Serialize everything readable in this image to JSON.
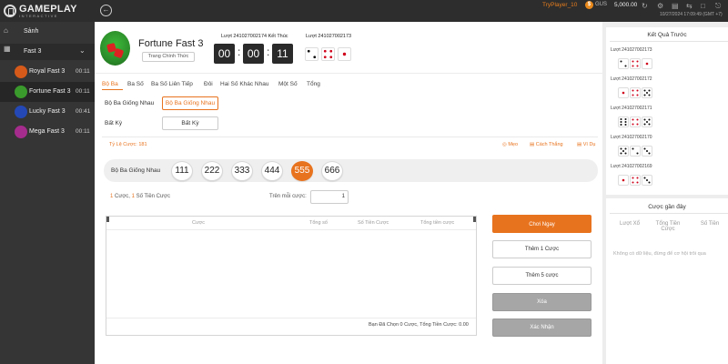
{
  "header": {
    "brand": "GAMEPLAY",
    "brand_sub": "INTERACTIVE",
    "player": "TryPlayer_10",
    "currency": "GUS",
    "balance": "5,000.00",
    "datetime": "10/27/2024 17:09:49 (GMT +7)",
    "back_icon": "arrow-left-icon"
  },
  "sidebar": {
    "home_label": "Sảnh",
    "category": "Fast 3",
    "games": [
      {
        "name": "Royal Fast 3",
        "time": "00:11",
        "color": "#d65a1a"
      },
      {
        "name": "Fortune Fast 3",
        "time": "00:11",
        "color": "#3a9a2c"
      },
      {
        "name": "Lucky Fast 3",
        "time": "00:41",
        "color": "#2448b5"
      },
      {
        "name": "Mega Fast 3",
        "time": "00:11",
        "color": "#a52c8c"
      }
    ]
  },
  "game": {
    "title": "Fortune Fast 3",
    "official_label": "Trang Chính Thức",
    "round_end_label": "Lượt 241027002174 Kết Thúc",
    "timer": [
      "00",
      "00",
      "11"
    ],
    "prev_round_label": "Lượt 241027002173",
    "prev_dice": [
      2,
      4,
      1
    ]
  },
  "tabs": [
    "Bộ Ba",
    "Ba Số",
    "Ba Số Liên Tiếp",
    "Đôi",
    "Hai Số Khác Nhau",
    "Một Số",
    "Tổng"
  ],
  "subtypes": {
    "row1_label": "Bộ Ba Giống Nhau",
    "row1_button": "Bộ Ba Giống Nhau",
    "row2_label": "Bất Kỳ",
    "row2_button": "Bất Kỳ"
  },
  "odds_label": "Tỷ Lệ Cược: 181",
  "hints": {
    "tips": "Mẹo",
    "how_to_win": "Cách Thắng",
    "example": "Ví Dụ"
  },
  "numbers": {
    "label": "Bộ Ba Giống Nhau",
    "options": [
      "111",
      "222",
      "333",
      "444",
      "555",
      "666"
    ],
    "selected": "555"
  },
  "bet_info": {
    "count_num": "1",
    "count_text": " Cược, ",
    "amount_num": "1",
    "amount_text": " Số Tiền Cược",
    "per_bet_label": "Trên mỗi cược:",
    "per_bet_value": "1"
  },
  "table": {
    "headers": [
      "Cược",
      "Tổng số",
      "Số Tiền Cược",
      "Tổng tiền cược"
    ],
    "summary": "Bạn Đã Chọn 0 Cược, Tổng Tiền Cược: 0.00"
  },
  "actions": {
    "play": "Chơi Ngay",
    "add1": "Thêm 1 Cược",
    "add5": "Thêm 5 cược",
    "clear": "Xóa",
    "confirm": "Xác Nhận"
  },
  "results": {
    "title": "Kết Quả Trước",
    "rounds": [
      {
        "label": "Lượt 241027002173",
        "dice": [
          2,
          4,
          1
        ]
      },
      {
        "label": "Lượt 241027002172",
        "dice": [
          1,
          4,
          5
        ]
      },
      {
        "label": "Lượt 241027002171",
        "dice": [
          6,
          4,
          5
        ]
      },
      {
        "label": "Lượt 241027002170",
        "dice": [
          5,
          2,
          3
        ]
      },
      {
        "label": "Lượt 241027002169",
        "dice": [
          1,
          4,
          3
        ]
      }
    ]
  },
  "recent_bets": {
    "title": "Cược gần đây",
    "headers": [
      "Lượt Xổ",
      "Tổng Tiền Cược",
      "Số Tiền"
    ],
    "empty_text": "Không có dữ liệu, đừng để cơ hội trôi qua"
  },
  "colors": {
    "accent": "#e8731e",
    "sidebar": "#353535",
    "topbar": "#2d2d2d"
  }
}
